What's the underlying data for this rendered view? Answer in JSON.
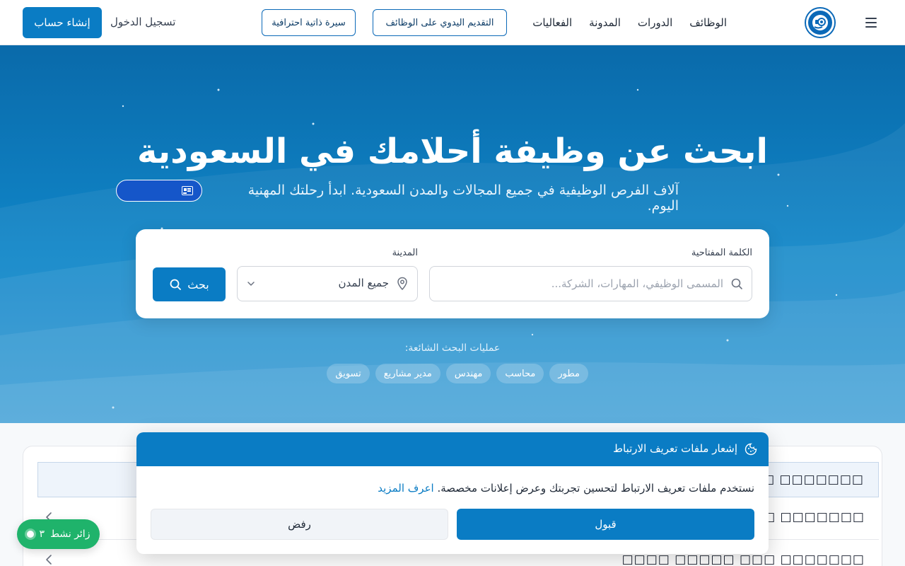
{
  "header": {
    "menu_icon": "hamburger-menu-icon",
    "logo_icon": "site-logo",
    "nav": [
      "الوظائف",
      "الدورات",
      "المدونة",
      "الفعاليات"
    ],
    "manual_apply": "التقديم اليدوي على الوظائف",
    "cv_button": "سيرة ذاتية احترافية",
    "login": "تسجيل الدخول",
    "signup": "إنشاء حساب"
  },
  "hero": {
    "title": "ابحث عن وظيفة أحلامك في السعودية",
    "subtitle": "آلاف الفرص الوظيفية في جميع المجالات والمدن السعودية. ابدأ رحلتك المهنية اليوم."
  },
  "search": {
    "keyword_label": "الكلمة المفتاحية",
    "keyword_placeholder": "المسمى الوظيفي، المهارات، الشركة...",
    "city_label": "المدينة",
    "city_value": "جميع المدن",
    "button": "بحث"
  },
  "popular": {
    "label": "عمليات البحث الشائعة:",
    "chips": [
      "مطور",
      "محاسب",
      "مهندس",
      "مدير مشاريع",
      "تسويق"
    ]
  },
  "table": {
    "head": "□□□□□□□ □□□□□□□",
    "rows": [
      "□□□□□□□ □□□□□□□□",
      "□□□□□□□ □□□ □□□□□ □□□□"
    ]
  },
  "cookie": {
    "title": "إشعار ملفات تعريف الارتباط",
    "text": "نستخدم ملفات تعريف الارتباط لتحسين تجربتك وعرض إعلانات مخصصة.",
    "learn_more": "اعرف المزيد",
    "accept": "قبول",
    "reject": "رفض"
  },
  "visitors": {
    "count": "٣",
    "label": "زائر نشط"
  },
  "colors": {
    "primary": "#0a7cc4",
    "hero_top": "#0a6aaa",
    "active_green": "#1fb36b"
  }
}
